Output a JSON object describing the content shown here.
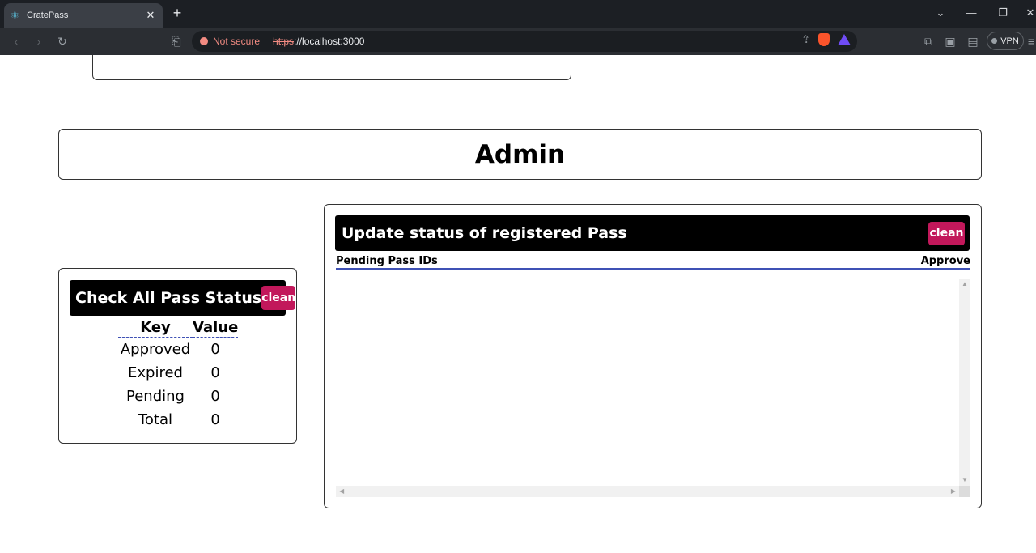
{
  "browser": {
    "tab_title": "CratePass",
    "new_tab_icon": "+",
    "security_label": "Not secure",
    "url_scheme": "https",
    "url_rest": "://localhost:3000",
    "vpn_label": "VPN",
    "icons": {
      "favicon": "react-icon",
      "close": "close-icon",
      "back": "back-arrow-icon",
      "forward": "forward-arrow-icon",
      "reload": "reload-icon",
      "bookmark": "bookmark-icon",
      "share": "share-icon",
      "brave": "brave-shield-icon",
      "rewards": "brave-rewards-icon",
      "extensions": "extensions-icon",
      "sidebar": "sidebar-icon",
      "wallet": "wallet-icon",
      "menu": "menu-icon"
    }
  },
  "page": {
    "admin_title": "Admin",
    "status_card": {
      "title": "Check All Pass Status",
      "clean_label": "clean",
      "headers": {
        "key": "Key",
        "value": "Value"
      },
      "rows": [
        {
          "key": "Approved",
          "value": "0"
        },
        {
          "key": "Expired",
          "value": "0"
        },
        {
          "key": "Pending",
          "value": "0"
        },
        {
          "key": "Total",
          "value": "0"
        }
      ]
    },
    "update_card": {
      "title": "Update status of registered Pass",
      "clean_label": "clean",
      "col_left": "Pending Pass IDs",
      "col_right": "Approve"
    }
  },
  "colors": {
    "accent_button": "#c2185b",
    "header_bar": "#000000",
    "table_rule": "#3f51b5",
    "chrome_dark": "#1c1f24"
  }
}
